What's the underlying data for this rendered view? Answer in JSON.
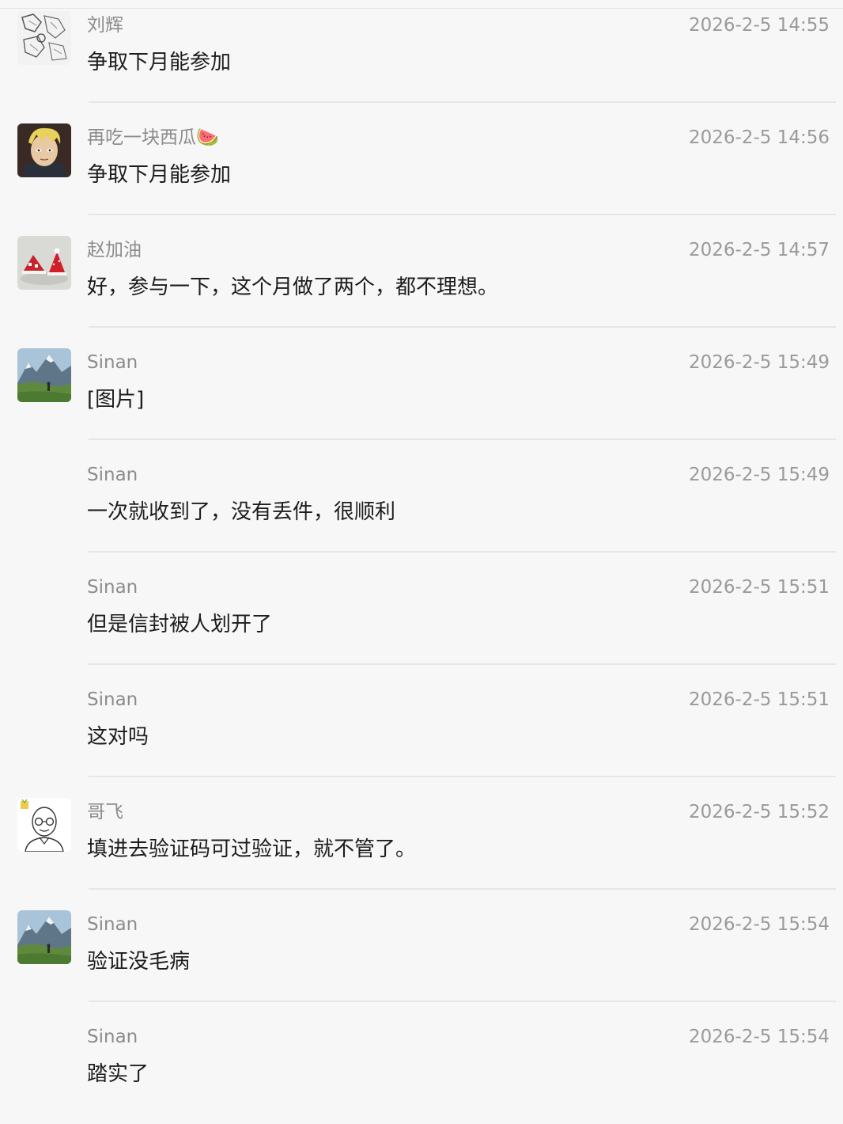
{
  "messages": [
    {
      "sender": "刘辉",
      "time": "2026-2-5 14:55",
      "text": "争取下月能参加",
      "avatar": "sketch-avatar"
    },
    {
      "sender": "再吃一块西瓜🍉",
      "time": "2026-2-5 14:56",
      "text": "争取下月能参加",
      "avatar": "anime-boy-avatar"
    },
    {
      "sender": "赵加油",
      "time": "2026-2-5 14:57",
      "text": "好，参与一下，这个月做了两个，都不理想。",
      "avatar": "christmas-hats-avatar"
    },
    {
      "sender": "Sinan",
      "time": "2026-2-5 15:49",
      "text": "[图片]",
      "avatar": "mountain-landscape-avatar"
    },
    {
      "sender": "Sinan",
      "time": "2026-2-5 15:49",
      "text": "一次就收到了，没有丢件，很顺利",
      "avatar": null
    },
    {
      "sender": "Sinan",
      "time": "2026-2-5 15:51",
      "text": "但是信封被人划开了",
      "avatar": null
    },
    {
      "sender": "Sinan",
      "time": "2026-2-5 15:51",
      "text": "这对吗",
      "avatar": null
    },
    {
      "sender": "哥飞",
      "time": "2026-2-5 15:52",
      "text": "填进去验证码可过验证，就不管了。",
      "avatar": "cartoon-man-glasses-avatar"
    },
    {
      "sender": "Sinan",
      "time": "2026-2-5 15:54",
      "text": "验证没毛病",
      "avatar": "mountain-landscape-avatar"
    },
    {
      "sender": "Sinan",
      "time": "2026-2-5 15:54",
      "text": "踏实了",
      "avatar": null
    }
  ]
}
